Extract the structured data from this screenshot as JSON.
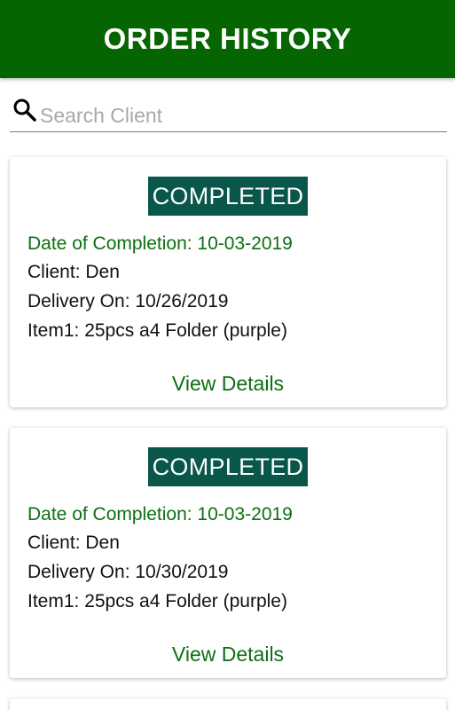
{
  "header": {
    "title": "ORDER HISTORY",
    "background": "#056500"
  },
  "search": {
    "placeholder": "Search Client",
    "value": "",
    "icon": "search-icon"
  },
  "orders": [
    {
      "status": "COMPLETED",
      "completion_label": "Date of Completion: 10-03-2019",
      "client_label": "Client: Den",
      "delivery_label": "Delivery On: 10/26/2019",
      "item_label": "Item1: 25pcs a4 Folder (purple)",
      "action_label": "View Details"
    },
    {
      "status": "COMPLETED",
      "completion_label": "Date of Completion: 10-03-2019",
      "client_label": "Client: Den",
      "delivery_label": "Delivery On: 10/30/2019",
      "item_label": "Item1: 25pcs a4 Folder (purple)",
      "action_label": "View Details"
    }
  ],
  "colors": {
    "accent_green": "#0d6f12",
    "badge_teal": "#08574a"
  }
}
